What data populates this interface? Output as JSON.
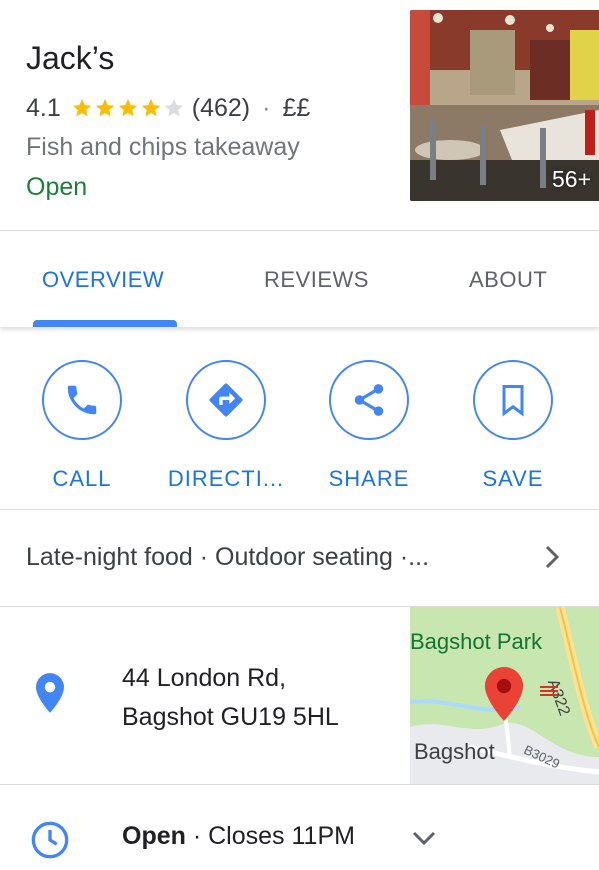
{
  "place": {
    "name": "Jack’s",
    "rating": "4.1",
    "rating_value": 4.1,
    "review_count": "(462)",
    "price": "££",
    "category": "Fish and chips takeaway",
    "status": "Open",
    "photo_count": "56+"
  },
  "tabs": [
    {
      "label": "OVERVIEW",
      "active": true
    },
    {
      "label": "REVIEWS",
      "active": false
    },
    {
      "label": "ABOUT",
      "active": false
    }
  ],
  "actions": [
    {
      "label": "CALL",
      "icon": "phone-icon"
    },
    {
      "label": "DIRECTI...",
      "icon": "directions-icon"
    },
    {
      "label": "SHARE",
      "icon": "share-icon"
    },
    {
      "label": "SAVE",
      "icon": "bookmark-icon"
    }
  ],
  "features": {
    "text": "Late-night food · Outdoor seating ·..."
  },
  "address": {
    "line1": "44 London Rd,",
    "line2": "Bagshot GU19 5HL",
    "map": {
      "park_label": "Bagshot Park",
      "town_label": "Bagshot",
      "road_a": "A322",
      "road_b": "B3029"
    }
  },
  "hours": {
    "status": "Open",
    "separator": " · ",
    "closes": "Closes 11PM"
  },
  "colors": {
    "accent": "#1a73e8",
    "star": "#fbbc04",
    "open": "#188038",
    "pin": "#4285f4"
  }
}
